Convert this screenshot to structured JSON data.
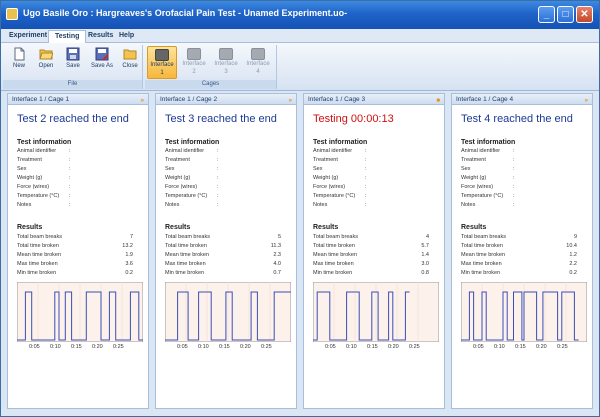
{
  "window": {
    "title": "Ugo Basile Oro : Hargreaves's Orofacial Pain Test - Unamed Experiment.uo-",
    "buttons": {
      "minimize": "_",
      "maximize": "□",
      "close": "✕"
    }
  },
  "menu": {
    "items": [
      "Experiment",
      "Testing",
      "Results",
      "Help"
    ],
    "active": "Testing"
  },
  "ribbon": {
    "file_group": "File",
    "cages_group": "Cages",
    "file_buttons": [
      {
        "label": "New",
        "icon": "new-file-icon"
      },
      {
        "label": "Open",
        "icon": "open-folder-icon"
      },
      {
        "label": "Save",
        "icon": "save-icon"
      },
      {
        "label": "Save As",
        "icon": "save-as-icon"
      },
      {
        "label": "Close",
        "icon": "close-folder-icon"
      }
    ],
    "cage_buttons": [
      {
        "line1": "Interface",
        "line2": "1",
        "selected": true
      },
      {
        "line1": "Interface",
        "line2": "2",
        "selected": false
      },
      {
        "line1": "Interface",
        "line2": "3",
        "selected": false
      },
      {
        "line1": "Interface",
        "line2": "4",
        "selected": false
      }
    ]
  },
  "colors": {
    "status_done": "#1f3a93",
    "status_running": "#cc1111",
    "chart_bg": "#fdf1ec",
    "chart_line": "#3a4fb5"
  },
  "info_labels": [
    "Animal identifier",
    "Treatment",
    "Sex",
    "Weight (g)",
    "Force (wires)",
    "Temperature (°C)",
    "Notes"
  ],
  "info_sep": ":",
  "result_labels": [
    "Total beam breaks",
    "Total time broken",
    "Mean time broken",
    "Max time broken",
    "Min time broken"
  ],
  "section_titles": {
    "info": "Test information",
    "results": "Results"
  },
  "axis_ticks": [
    "0:05",
    "0:10",
    "0:15",
    "0:20",
    "0:25"
  ],
  "panels": [
    {
      "title": "Interface 1 / Cage 1",
      "status": "Test 2 reached the end",
      "running": false,
      "header_icon": "forward-icon",
      "header_glyph": "»",
      "results": [
        "7",
        "13.2",
        "1.9",
        "3.6",
        "0.2"
      ],
      "chart_data": {
        "type": "line",
        "series": [
          {
            "x": [
              0,
              2.0,
              2.0,
              3.5,
              3.5,
              9.0,
              9.0,
              10.0,
              10.0,
              11.5,
              11.5,
              13.0,
              13.0,
              16.5,
              16.5,
              20.0,
              20.0,
              22.0,
              22.0,
              23.5,
              23.5,
              27.0,
              27.0,
              29.0,
              29.0,
              30.0
            ],
            "y": [
              0,
              0,
              1,
              1,
              0,
              0,
              1,
              1,
              0,
              0,
              1,
              1,
              0,
              0,
              1,
              1,
              0,
              0,
              1,
              1,
              0,
              0,
              1,
              1,
              0,
              0
            ]
          }
        ],
        "xlim": [
          0,
          30
        ],
        "ylim": [
          0,
          1
        ],
        "x_ticks": [
          "0:05",
          "0:10",
          "0:15",
          "0:20",
          "0:25"
        ]
      }
    },
    {
      "title": "Interface 1 / Cage 2",
      "status": "Test 3 reached the end",
      "running": false,
      "header_icon": "forward-icon",
      "header_glyph": "»",
      "results": [
        "5",
        "11.3",
        "2.3",
        "4.0",
        "0.7"
      ],
      "chart_data": {
        "type": "line",
        "series": [
          {
            "x": [
              0,
              3.0,
              3.0,
              5.5,
              5.5,
              8.0,
              8.0,
              11.0,
              11.0,
              14.5,
              14.5,
              16.0,
              16.0,
              20.5,
              20.5,
              22.0,
              22.0,
              26.0,
              26.0,
              30.0
            ],
            "y": [
              0,
              0,
              1,
              1,
              0,
              0,
              1,
              1,
              0,
              0,
              1,
              1,
              0,
              0,
              1,
              1,
              0,
              0,
              1,
              1
            ]
          }
        ],
        "xlim": [
          0,
          30
        ],
        "ylim": [
          0,
          1
        ],
        "x_ticks": [
          "0:05",
          "0:10",
          "0:15",
          "0:20",
          "0:25"
        ]
      }
    },
    {
      "title": "Interface 1 / Cage 3",
      "status": "Testing 00:00:13",
      "running": true,
      "header_icon": "stop-icon",
      "header_glyph": "■",
      "results": [
        "4",
        "5.7",
        "1.4",
        "3.0",
        "0.8"
      ],
      "chart_data": {
        "type": "line",
        "series": [
          {
            "x": [
              0,
              1.0,
              1.0,
              4.0,
              4.0,
              8.0,
              8.0,
              11.0,
              11.0,
              14.0,
              14.0,
              15.5,
              15.5,
              18.0,
              18.0,
              19.0,
              19.0,
              22.0,
              22.0,
              23.0
            ],
            "y": [
              0,
              0,
              1,
              1,
              0,
              0,
              1,
              1,
              0,
              0,
              1,
              1,
              0,
              0,
              1,
              1,
              0,
              0,
              1,
              1
            ]
          }
        ],
        "xlim": [
          0,
          30
        ],
        "ylim": [
          0,
          1
        ],
        "x_ticks": [
          "0:05",
          "0:10",
          "0:15",
          "0:20",
          "0:25"
        ]
      }
    },
    {
      "title": "Interface 1 / Cage 4",
      "status": "Test 4 reached the end",
      "running": false,
      "header_icon": "forward-icon",
      "header_glyph": "»",
      "results": [
        "9",
        "10.4",
        "1.2",
        "2.2",
        "0.2"
      ],
      "chart_data": {
        "type": "line",
        "series": [
          {
            "x": [
              0,
              2.0,
              2.0,
              3.0,
              3.0,
              5.0,
              5.0,
              6.0,
              6.0,
              10.0,
              10.0,
              11.0,
              11.0,
              12.5,
              12.5,
              14.5,
              14.5,
              15.0,
              15.0,
              18.0,
              18.0,
              19.5,
              19.5,
              23.0,
              23.0,
              24.0,
              24.0,
              27.0,
              27.0,
              28.0
            ],
            "y": [
              0,
              0,
              1,
              1,
              0,
              0,
              1,
              1,
              0,
              0,
              1,
              1,
              0,
              0,
              1,
              1,
              0,
              0,
              1,
              1,
              0,
              0,
              1,
              1,
              0,
              0,
              1,
              1,
              0,
              0
            ]
          }
        ],
        "xlim": [
          0,
          30
        ],
        "ylim": [
          0,
          1
        ],
        "x_ticks": [
          "0:05",
          "0:10",
          "0:15",
          "0:20",
          "0:25"
        ]
      }
    }
  ]
}
